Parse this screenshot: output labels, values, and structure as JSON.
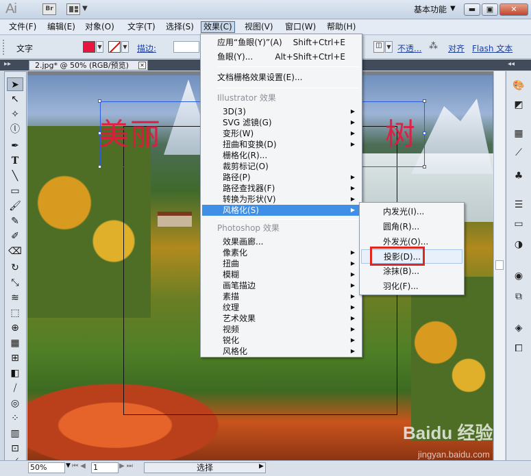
{
  "app": {
    "logo": "Ai",
    "bridge": "Br",
    "workspace": "基本功能"
  },
  "menubar": [
    "文件(F)",
    "编辑(E)",
    "对象(O)",
    "文字(T)",
    "选择(S)",
    "效果(C)",
    "视图(V)",
    "窗口(W)",
    "帮助(H)"
  ],
  "control": {
    "type_label": "文字",
    "stroke_label": "描边:",
    "opacity_label": "不透...",
    "align_label": "对齐",
    "flash_label": "Flash 文本"
  },
  "doc_tab": "2.jpg* @ 50% (RGB/预览)",
  "canvas_text": {
    "left": "美丽",
    "right": "树"
  },
  "effect_menu": {
    "apply": "应用“鱼眼(Y)”(A)",
    "apply_sc": "Shift+Ctrl+E",
    "fisheye": "鱼眼(Y)...",
    "fisheye_sc": "Alt+Shift+Ctrl+E",
    "raster_settings": "文档栅格效果设置(E)...",
    "illustrator_header": "Illustrator 效果",
    "illustrator_items": [
      "3D(3)",
      "SVG 滤镜(G)",
      "变形(W)",
      "扭曲和变换(D)",
      "栅格化(R)...",
      "裁剪标记(O)",
      "路径(P)",
      "路径查找器(F)",
      "转换为形状(V)",
      "风格化(S)"
    ],
    "photoshop_header": "Photoshop 效果",
    "photoshop_items": [
      "效果画廊...",
      "像素化",
      "扭曲",
      "模糊",
      "画笔描边",
      "素描",
      "纹理",
      "艺术效果",
      "视频",
      "锐化",
      "风格化"
    ]
  },
  "stylize_submenu": [
    "内发光(I)...",
    "圆角(R)...",
    "外发光(O)...",
    "投影(D)...",
    "涂抹(B)...",
    "羽化(F)..."
  ],
  "status": {
    "zoom": "50%",
    "page": "1",
    "mode": "选择"
  },
  "watermark": {
    "main": "Baidu 经验",
    "sub": "jingyan.baidu.com"
  },
  "colors": {
    "fill": "#e8163f",
    "highlight": "#3f8fe6",
    "callout": "#e0271e"
  }
}
